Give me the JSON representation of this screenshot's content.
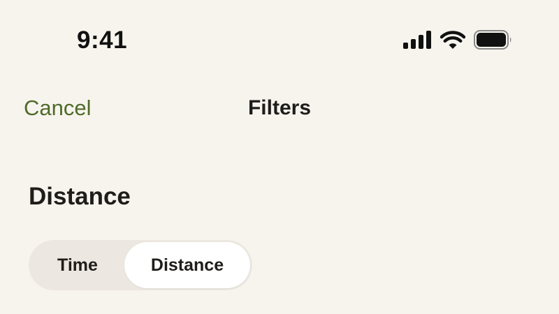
{
  "status_bar": {
    "time": "9:41",
    "icons": [
      "cellular-signal-icon",
      "wifi-icon",
      "battery-icon"
    ]
  },
  "nav": {
    "cancel_label": "Cancel",
    "title": "Filters"
  },
  "section": {
    "title": "Distance"
  },
  "segmented_control": {
    "options": [
      {
        "label": "Time",
        "selected": false
      },
      {
        "label": "Distance",
        "selected": true
      }
    ]
  },
  "colors": {
    "background": "#f7f4ee",
    "accent": "#4f6b2a",
    "segment_track": "#ece7e0",
    "segment_selected": "#ffffff",
    "text": "#1f1d1a"
  }
}
